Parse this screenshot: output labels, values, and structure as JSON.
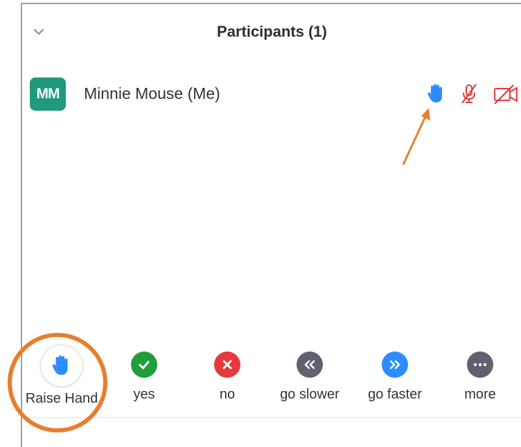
{
  "header": {
    "title": "Participants (1)",
    "collapse_icon": "chevron-down-icon"
  },
  "participant": {
    "initials": "MM",
    "name": "Minnie Mouse (Me)",
    "avatar_color": "#1f9a7a",
    "status_icons": [
      "raised-hand-icon",
      "muted-microphone-icon",
      "video-off-icon"
    ]
  },
  "actions": [
    {
      "label": "Raise Hand",
      "icon": "raise-hand-icon",
      "color": "#2d8cff"
    },
    {
      "label": "yes",
      "icon": "checkmark-icon",
      "color": "#1f9e3a"
    },
    {
      "label": "no",
      "icon": "x-icon",
      "color": "#e5393b"
    },
    {
      "label": "go slower",
      "icon": "double-chevron-left-icon",
      "color": "#5f6170"
    },
    {
      "label": "go faster",
      "icon": "double-chevron-right-icon",
      "color": "#2d8cff"
    },
    {
      "label": "more",
      "icon": "ellipsis-icon",
      "color": "#5f6170"
    }
  ],
  "colors": {
    "accent_blue": "#2d8cff",
    "alert_red": "#e5393b",
    "annotation_orange": "#e97d2c"
  }
}
